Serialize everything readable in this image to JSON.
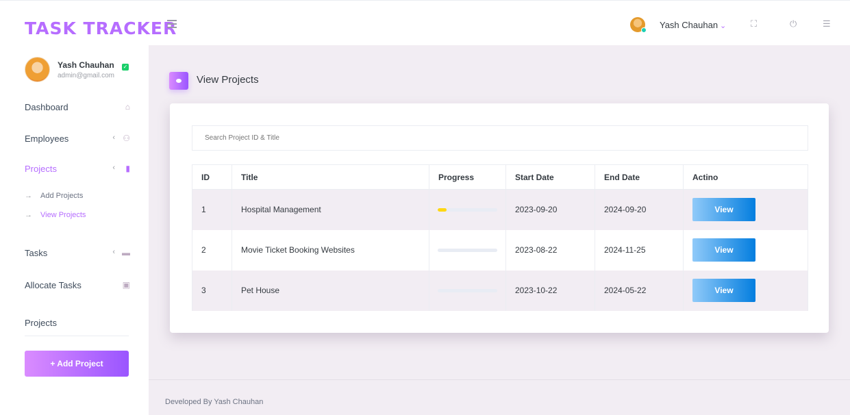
{
  "brand": "TASK TRACKER",
  "topbar": {
    "user_name": "Yash Chauhan",
    "chevron": "⌄",
    "icons": [
      "menu-icon",
      "fullscreen-icon",
      "power-icon",
      "list-icon"
    ]
  },
  "sidebar": {
    "profile": {
      "name": "Yash Chauhan",
      "email": "admin@gmail.com"
    },
    "items": [
      {
        "label": "Dashboard",
        "icon": "home-icon"
      },
      {
        "label": "Employees",
        "icon": "users-icon"
      },
      {
        "label": "Projects",
        "icon": "book-icon"
      },
      {
        "label": "Tasks",
        "icon": "briefcase-icon"
      },
      {
        "label": "Allocate Tasks",
        "icon": "briefcase-plus-icon"
      }
    ],
    "sub_items": [
      {
        "label": "Add Projects"
      },
      {
        "label": "View Projects"
      }
    ],
    "heading": "Projects",
    "add_button": "+ Add Project"
  },
  "page": {
    "title": "View Projects",
    "search_placeholder": "Search Project ID & Title"
  },
  "table": {
    "headers": [
      "ID",
      "Title",
      "Progress",
      "Start Date",
      "End Date",
      "Actino"
    ],
    "rows": [
      {
        "id": "1",
        "title": "Hospital Management",
        "progress": 0.15,
        "start": "2023-09-20",
        "end": "2024-09-20",
        "action": "View"
      },
      {
        "id": "2",
        "title": "Movie Ticket Booking Websites",
        "progress": 0,
        "start": "2023-08-22",
        "end": "2024-11-25",
        "action": "View"
      },
      {
        "id": "3",
        "title": "Pet House",
        "progress": 0,
        "start": "2023-10-22",
        "end": "2024-05-22",
        "action": "View"
      }
    ]
  },
  "footer": "Developed By Yash Chauhan",
  "colors": {
    "accent": "#b66dff",
    "progress": "#fed713",
    "button": "#047edf",
    "background": "#f2edf3"
  }
}
